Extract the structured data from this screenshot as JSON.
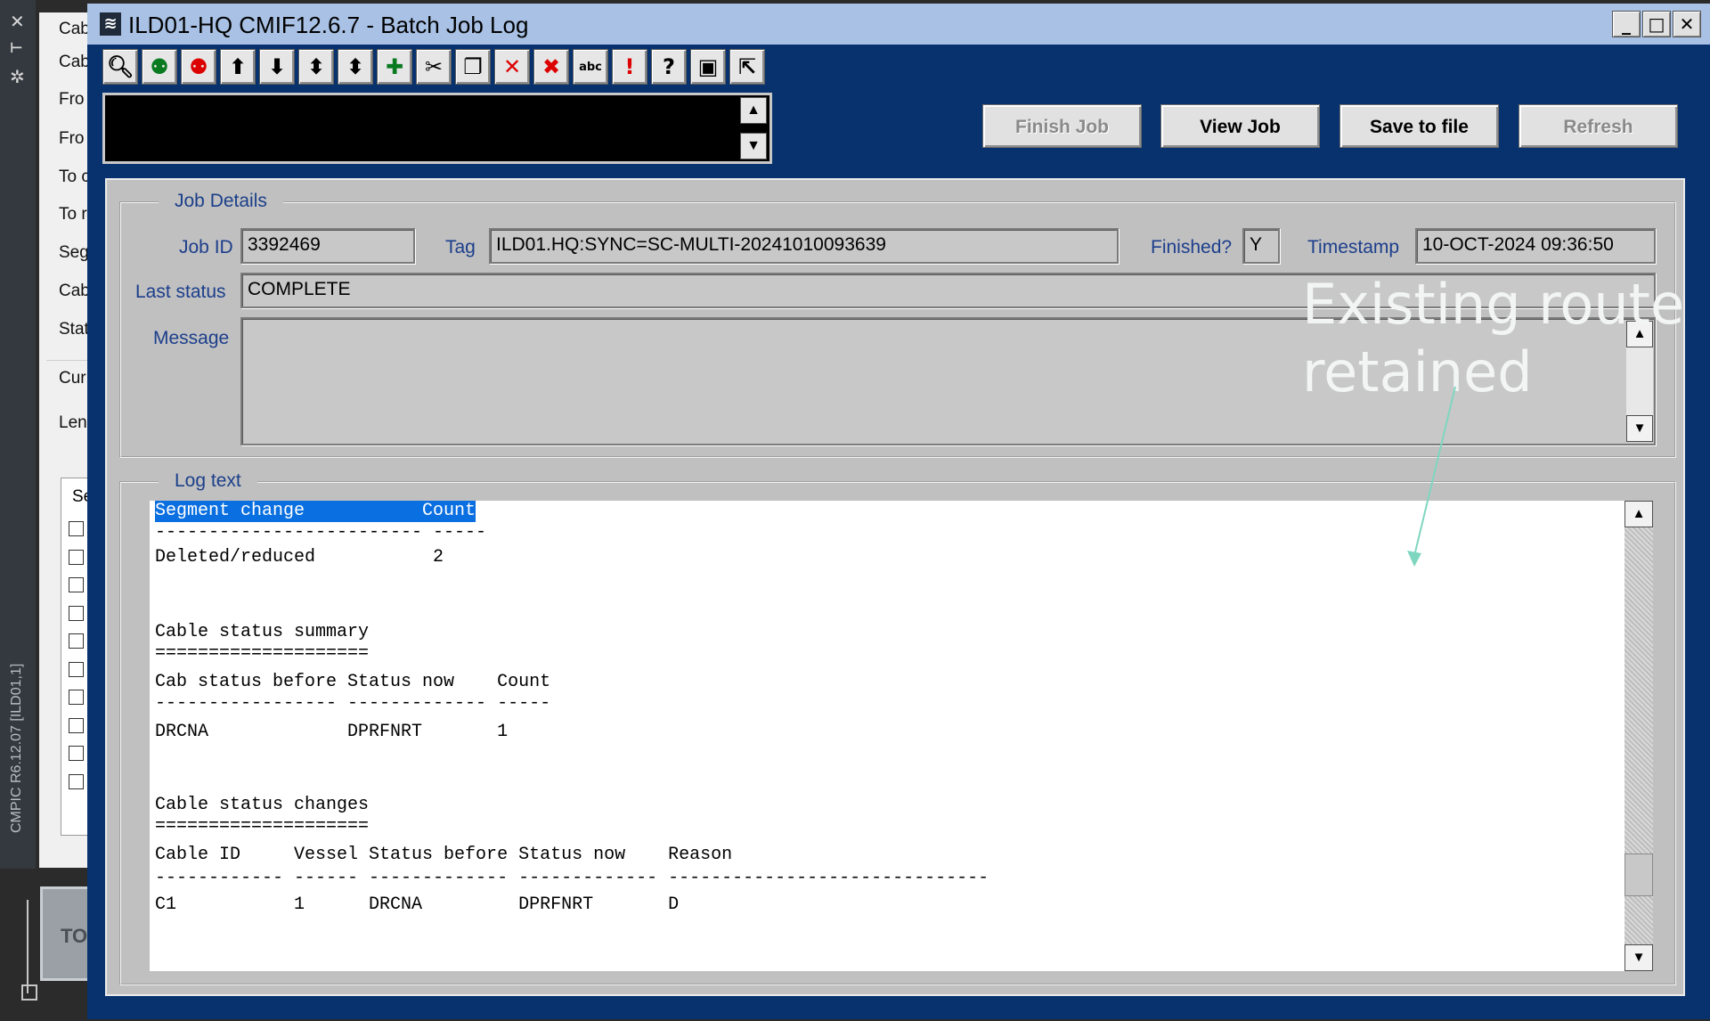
{
  "background": {
    "vertical_label": "CMPIC R6.12.07 [ILD01,1]",
    "side_labels": [
      "Cab",
      "Cab",
      "Fro",
      "Fro",
      "To c",
      "To r",
      "Seg",
      "Cab",
      "Stat",
      "Cur",
      "Len"
    ],
    "list_header": "Se",
    "tile_label": "TO"
  },
  "window": {
    "title": "ILD01-HQ CMIF12.6.7 - Batch Job Log",
    "controls": {
      "minimize": "_",
      "maximize": "□",
      "close": "✕"
    }
  },
  "toolbar": {
    "icons": [
      "find-icon",
      "bug-icon",
      "bug-red-icon",
      "arrow-up-icon",
      "arrow-down-icon",
      "arrow-updown-icon",
      "arrow-updown2-icon",
      "insert-record-icon",
      "cut-icon",
      "copy-icon",
      "delete-icon",
      "delete-all-icon",
      "spellcheck-icon",
      "alert-icon",
      "help-icon",
      "save-icon",
      "exit-icon"
    ]
  },
  "buttons": {
    "finish_job": "Finish Job",
    "view_job": "View Job",
    "save_to_file": "Save to file",
    "refresh": "Refresh"
  },
  "job_details": {
    "legend": "Job Details",
    "job_id_label": "Job ID",
    "job_id": "3392469",
    "tag_label": "Tag",
    "tag": "ILD01.HQ:SYNC=SC-MULTI-20241010093639",
    "finished_label": "Finished?",
    "finished": "Y",
    "timestamp_label": "Timestamp",
    "timestamp": "10-OCT-2024 09:36:50",
    "last_status_label": "Last status",
    "last_status": "COMPLETE",
    "message_label": "Message",
    "message": ""
  },
  "log": {
    "legend": "Log text",
    "lines": [
      "Segment change           Count",
      "------------------------- -----",
      "Deleted/reduced           2",
      "",
      "",
      "Cable status summary",
      "====================",
      "Cab status before Status now    Count",
      "----------------- ------------- -----",
      "DRCNA             DPRFNRT       1",
      "",
      "",
      "Cable status changes",
      "====================",
      "Cable ID     Vessel Status before Status now    Reason",
      "------------ ------ ------------- ------------- ------------------------------",
      "C1           1      DRCNA         DPRFNRT       D"
    ]
  },
  "annotation": {
    "line1": "Existing route",
    "line2": "retained",
    "arrow_color": "#7fd6c0"
  }
}
